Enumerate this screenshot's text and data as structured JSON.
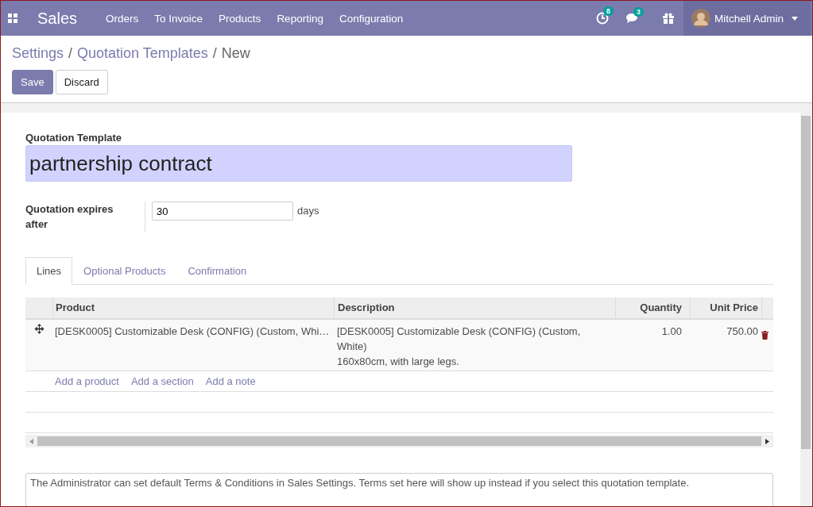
{
  "navbar": {
    "app": "Sales",
    "menu": [
      "Orders",
      "To Invoice",
      "Products",
      "Reporting",
      "Configuration"
    ],
    "activity_count": "8",
    "message_count": "3",
    "user": "Mitchell Admin"
  },
  "breadcrumbs": [
    "Settings",
    "Quotation Templates",
    "New"
  ],
  "breadcrumb_separator": "/",
  "buttons": [
    {
      "label": "Save",
      "kind": "primary"
    },
    {
      "label": "Discard",
      "kind": "secondary"
    }
  ],
  "form": {
    "name_label": "Quotation Template",
    "name_value": "partnership contract",
    "expires_label": "Quotation expires after",
    "expires_value": "30",
    "expires_unit": "days"
  },
  "tabs": [
    {
      "label": "Lines",
      "selected": true
    },
    {
      "label": "Optional Products",
      "selected": false
    },
    {
      "label": "Confirmation",
      "selected": false
    }
  ],
  "table": {
    "columns": [
      "Product",
      "Description",
      "Quantity",
      "Unit Price"
    ],
    "rows": [
      {
        "product": "[DESK0005] Customizable Desk (CONFIG) (Custom, Whi…",
        "description": [
          "[DESK0005] Customizable Desk (CONFIG) (Custom, White)",
          "160x80cm, with large legs."
        ],
        "quantity": "1.00",
        "unit_price": "750.00"
      }
    ],
    "add_links": [
      "Add a product",
      "Add a section",
      "Add a note"
    ]
  },
  "terms": {
    "placeholder": "The Administrator can set default Terms & Conditions in Sales Settings. Terms set here will show up instead if you select this quotation template."
  }
}
